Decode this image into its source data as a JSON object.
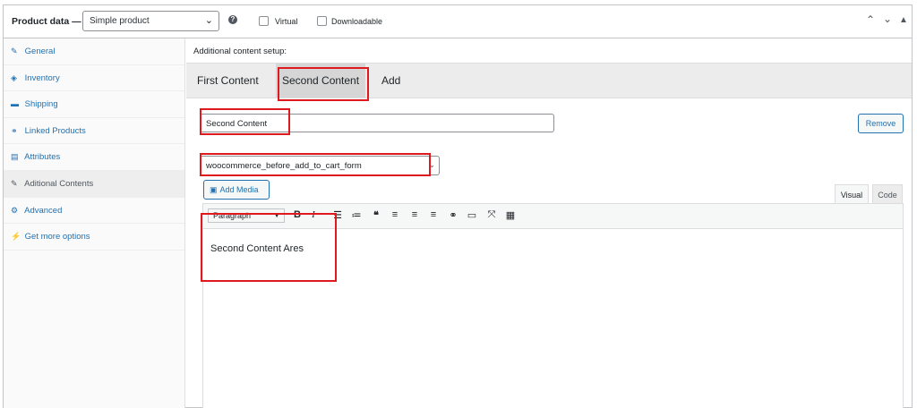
{
  "header": {
    "title": "Product data —",
    "product_type": "Simple product",
    "help_glyph": "?",
    "virtual_label": "Virtual",
    "downloadable_label": "Downloadable",
    "arrows": [
      "⌃",
      "⌄",
      "⏶"
    ]
  },
  "sidebar": {
    "items": [
      {
        "label": "General",
        "icon": "wrench-icon",
        "glyph": "✎"
      },
      {
        "label": "Inventory",
        "icon": "tag-icon",
        "glyph": "◈"
      },
      {
        "label": "Shipping",
        "icon": "truck-icon",
        "glyph": "▬"
      },
      {
        "label": "Linked Products",
        "icon": "link-icon",
        "glyph": "⚭"
      },
      {
        "label": "Attributes",
        "icon": "list-icon",
        "glyph": "▤"
      },
      {
        "label": "Aditional Contents",
        "icon": "wrench-icon",
        "glyph": "✎"
      },
      {
        "label": "Advanced",
        "icon": "gear-icon",
        "glyph": "⚙"
      },
      {
        "label": "Get more options",
        "icon": "plugin-icon",
        "glyph": "⚡"
      }
    ]
  },
  "main": {
    "setup_label": "Additional content setup:",
    "tabs": [
      {
        "label": "First Content"
      },
      {
        "label": "Second Content"
      },
      {
        "label": "Add"
      }
    ],
    "content_title_value": "Second Content",
    "remove_label": "Remove",
    "hook_value": "woocommerce_before_add_to_cart_form",
    "add_media_label": "Add Media",
    "editor_tabs": {
      "visual": "Visual",
      "code": "Code"
    },
    "paragraph_format": "Paragraph",
    "editor_body": "Second Content Ares"
  },
  "colors": {
    "accent": "#2271b1",
    "highlight_box": "#e0191f"
  }
}
